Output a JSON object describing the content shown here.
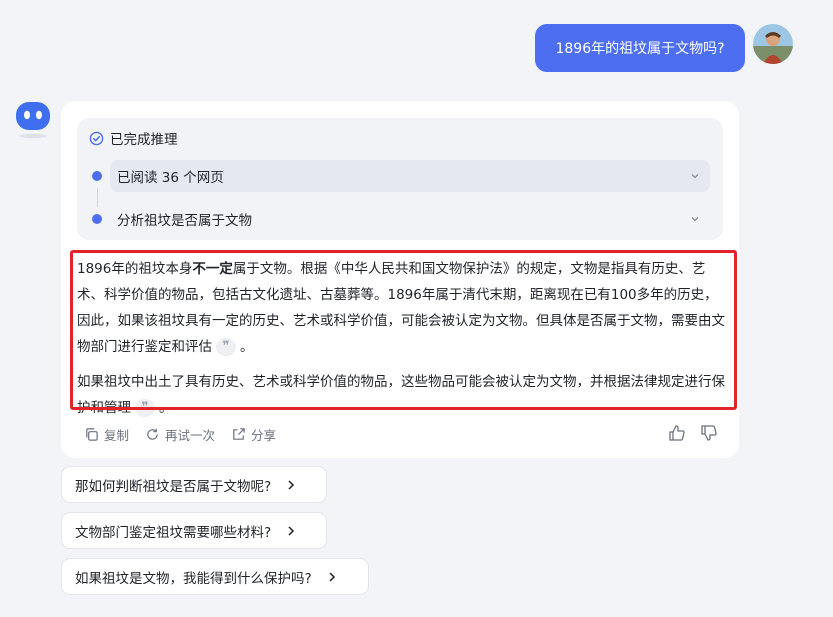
{
  "user_message": "1896年的祖坟属于文物吗?",
  "reasoning": {
    "status": "已完成推理",
    "steps": [
      "已阅读 36 个网页",
      "分析祖坟是否属于文物"
    ]
  },
  "answer": {
    "p1_prefix": "1896年的祖坟本身",
    "p1_bold": "不一定",
    "p1_rest": "属于文物。根据《中华人民共和国文物保护法》的规定，文物是指具有历史、艺术、科学价值的物品，包括古文化遗址、古墓葬等。1896年属于清代末期，距离现在已有100多年的历史，因此，如果该祖坟具有一定的历史、艺术或科学价值，可能会被认定为文物。但具体是否属于文物，需要由文物部门进行鉴定和评估",
    "p1_end": "。",
    "p2_text": "如果祖坟中出土了具有历史、艺术或科学价值的物品，这些物品可能会被认定为文物，并根据法律规定进行保护和管理",
    "p2_end": "。",
    "ref_glyph": "❞"
  },
  "actions": {
    "copy": "复制",
    "retry": "再试一次",
    "share": "分享"
  },
  "suggestions": [
    "那如何判断祖坟是否属于文物呢?",
    "文物部门鉴定祖坟需要哪些材料?",
    "如果祖坟是文物，我能得到什么保护吗?"
  ],
  "colors": {
    "accent": "#4e6ef2",
    "highlight": "#e2232a",
    "background": "#f3f4f8"
  },
  "icons": [
    "checklist-icon",
    "chevron-down-icon",
    "copy-icon",
    "refresh-icon",
    "share-icon",
    "thumbs-up-icon",
    "thumbs-down-icon",
    "chevron-right-icon"
  ]
}
